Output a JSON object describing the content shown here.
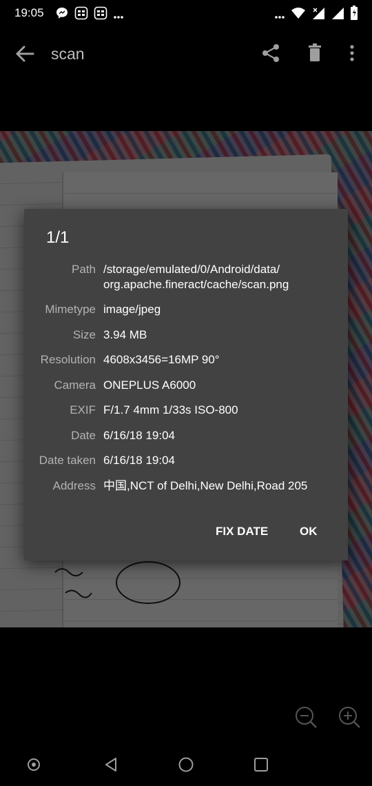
{
  "status_bar": {
    "time": "19:05",
    "left_icons": [
      "messenger-chat-icon",
      "notification-icon",
      "notification-icon",
      "more-notifications-icon"
    ],
    "right_icons": [
      "more-icon",
      "wifi-icon",
      "signal-icon",
      "signal-icon",
      "battery-icon"
    ]
  },
  "toolbar": {
    "title": "scan",
    "icons": [
      "back-arrow-icon",
      "share-icon",
      "delete-icon",
      "more-vert-icon"
    ]
  },
  "dialog": {
    "title": "1/1",
    "details": [
      {
        "label": "Path",
        "value": "/storage/emulated/0/Android/data/ org.apache.fineract/cache/scan.png"
      },
      {
        "label": "Mimetype",
        "value": "image/jpeg"
      },
      {
        "label": "Size",
        "value": "3.94 MB"
      },
      {
        "label": "Resolution",
        "value": "4608x3456=16MP 90°"
      },
      {
        "label": "Camera",
        "value": "ONEPLUS A6000"
      },
      {
        "label": "EXIF",
        "value": "F/1.7 4mm 1/33s ISO-800"
      },
      {
        "label": "Date",
        "value": "6/16/18 19:04"
      },
      {
        "label": "Date taken",
        "value": "6/16/18 19:04"
      },
      {
        "label": "Address",
        "value": "中国,NCT of Delhi,New Delhi,Road 205"
      }
    ],
    "fix_date_label": "FIX DATE",
    "ok_label": "OK"
  },
  "zoom": {
    "icons": [
      "zoom-out-icon",
      "zoom-in-icon"
    ]
  },
  "nav_bar": {
    "icons": [
      "assistant-icon",
      "back-icon",
      "home-icon",
      "recents-icon"
    ]
  },
  "colors": {
    "dialog_bg": "#424242",
    "label_text": "#b3b3b3",
    "value_text": "#ffffff",
    "toolbar_title": "#bdbdbd"
  }
}
